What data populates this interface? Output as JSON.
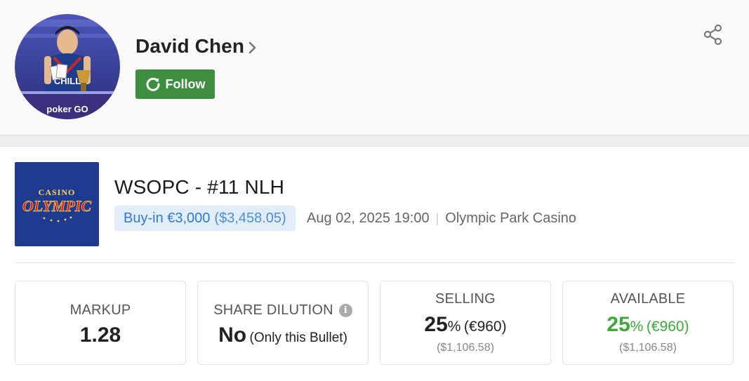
{
  "player": {
    "name": "David Chen",
    "follow_label": "Follow",
    "avatar_caption": "poker GO"
  },
  "event": {
    "title": "WSOPC - #11 NLH",
    "buyin_eur": "Buy-in €3,000",
    "buyin_usd": "($3,458.05)",
    "datetime": "Aug 02, 2025 19:00",
    "separator": "|",
    "venue": "Olympic Park Casino",
    "logo_top": "CASINO",
    "logo_main": "OLYMPIC"
  },
  "stats": {
    "markup": {
      "label": "MARKUP",
      "value": "1.28"
    },
    "dilution": {
      "label": "SHARE DILUTION",
      "value": "No",
      "note": "(Only this Bullet)"
    },
    "selling": {
      "label": "SELLING",
      "percent": "25",
      "percent_sign": "%",
      "eur": "(€960)",
      "usd": "($1,106.58)"
    },
    "available": {
      "label": "AVAILABLE",
      "percent": "25",
      "percent_sign": "%",
      "eur": "(€960)",
      "usd": "($1,106.58)"
    }
  },
  "colors": {
    "follow_bg": "#3e8e41",
    "buyin_text": "#2f7bd1",
    "buyin_bg": "#e3edf9",
    "available_green": "#3fa83a"
  },
  "icons": {
    "share": "share-icon",
    "follow": "refresh-icon",
    "chevron": "chevron-right-icon",
    "info": "info-icon"
  }
}
